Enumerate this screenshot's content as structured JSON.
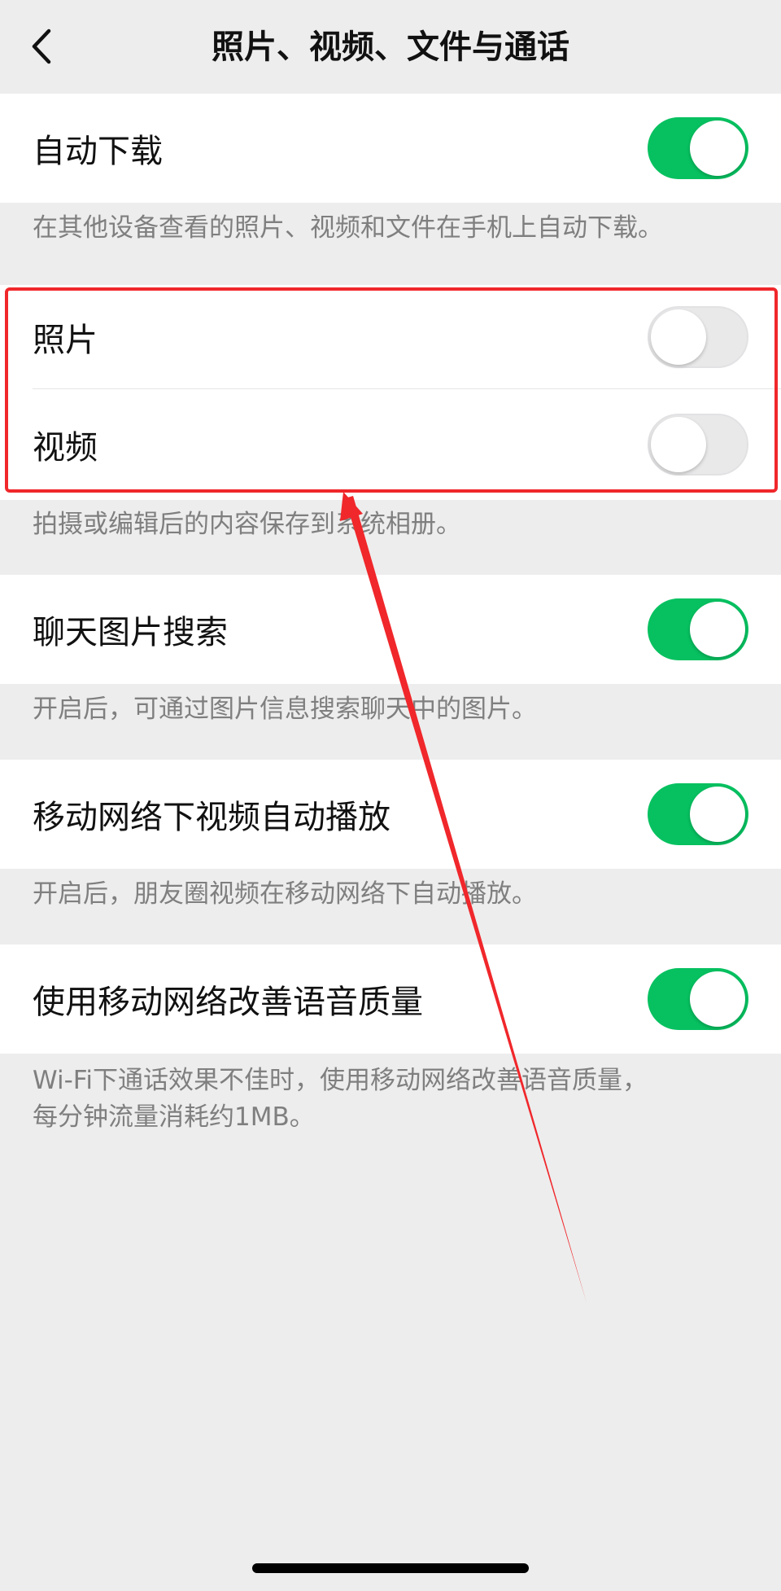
{
  "nav": {
    "title": "照片、视频、文件与通话",
    "back_icon": "chevron-left-icon"
  },
  "auto_download": {
    "label": "自动下载",
    "enabled": true,
    "footnote": "在其他设备查看的照片、视频和文件在手机上自动下载。"
  },
  "save_to_album": {
    "photos": {
      "label": "照片",
      "enabled": false
    },
    "videos": {
      "label": "视频",
      "enabled": false
    },
    "footnote": "拍摄或编辑后的内容保存到系统相册。"
  },
  "chat_image_search": {
    "label": "聊天图片搜索",
    "enabled": true,
    "footnote": "开启后，可通过图片信息搜索聊天中的图片。"
  },
  "mobile_autoplay": {
    "label": "移动网络下视频自动播放",
    "enabled": true,
    "footnote": "开启后，朋友圈视频在移动网络下自动播放。"
  },
  "voice_quality": {
    "label": "使用移动网络改善语音质量",
    "enabled": true,
    "footnote_line1": "Wi-Fi下通话效果不佳时，使用移动网络改善语音质量，",
    "footnote_line2": "每分钟流量消耗约1MB。"
  },
  "colors": {
    "toggle_on": "#07c160",
    "toggle_off": "#e9e9ea",
    "annotation_red": "#f0272b",
    "background": "#ededed"
  }
}
